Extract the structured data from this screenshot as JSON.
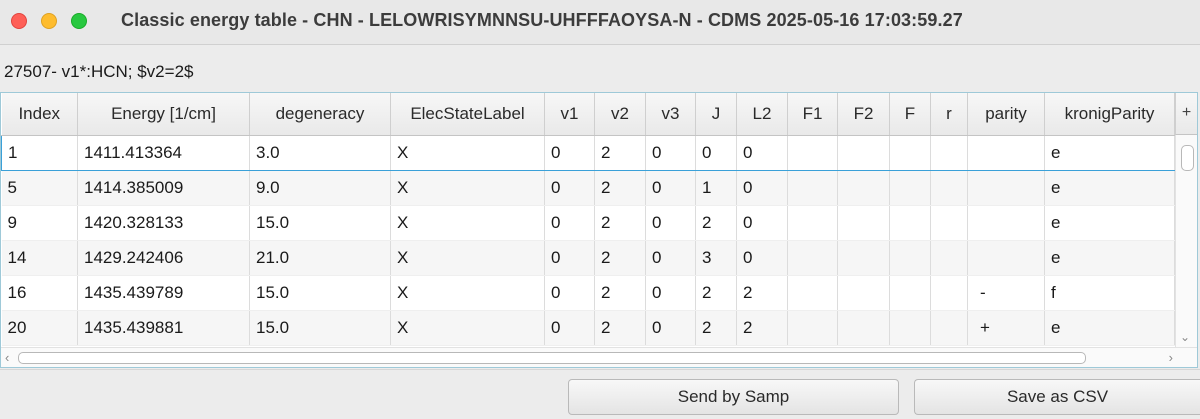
{
  "window": {
    "title": "Classic energy table - CHN - LELOWRISYMNNSU-UHFFFAOYSA-N - CDMS 2025-05-16 17:03:59.27"
  },
  "subtitle": "27507- v1*:HCN; $v2=2$",
  "table": {
    "columns": [
      "Index",
      "Energy  [1/cm]",
      "degeneracy",
      "ElecStateLabel",
      "v1",
      "v2",
      "v3",
      "J",
      "L2",
      "F1",
      "F2",
      "F",
      "r",
      "parity",
      "kronigParity"
    ],
    "corner_button": "+",
    "rows": [
      [
        "1",
        "1411.413364",
        "3.0",
        "X",
        "0",
        "2",
        "0",
        "0",
        "0",
        "",
        "",
        "",
        "",
        "",
        "e"
      ],
      [
        "5",
        "1414.385009",
        "9.0",
        "X",
        "0",
        "2",
        "0",
        "1",
        "0",
        "",
        "",
        "",
        "",
        "",
        "e"
      ],
      [
        "9",
        "1420.328133",
        "15.0",
        "X",
        "0",
        "2",
        "0",
        "2",
        "0",
        "",
        "",
        "",
        "",
        "",
        "e"
      ],
      [
        "14",
        "1429.242406",
        "21.0",
        "X",
        "0",
        "2",
        "0",
        "3",
        "0",
        "",
        "",
        "",
        "",
        "",
        "e"
      ],
      [
        "16",
        "1435.439789",
        "15.0",
        "X",
        "0",
        "2",
        "0",
        "2",
        "2",
        "",
        "",
        "",
        "",
        "-",
        "f"
      ],
      [
        "20",
        "1435.439881",
        "15.0",
        "X",
        "0",
        "2",
        "0",
        "2",
        "2",
        "",
        "",
        "",
        "",
        "+",
        "e"
      ]
    ],
    "selected_row": 0
  },
  "buttons": {
    "send_samp": "Send by Samp",
    "save_csv": "Save as CSV"
  },
  "colors": {
    "close": "#fe5f57",
    "minimize": "#febc2e",
    "maximize": "#28c840",
    "selection_border": "#3aa0d8"
  }
}
